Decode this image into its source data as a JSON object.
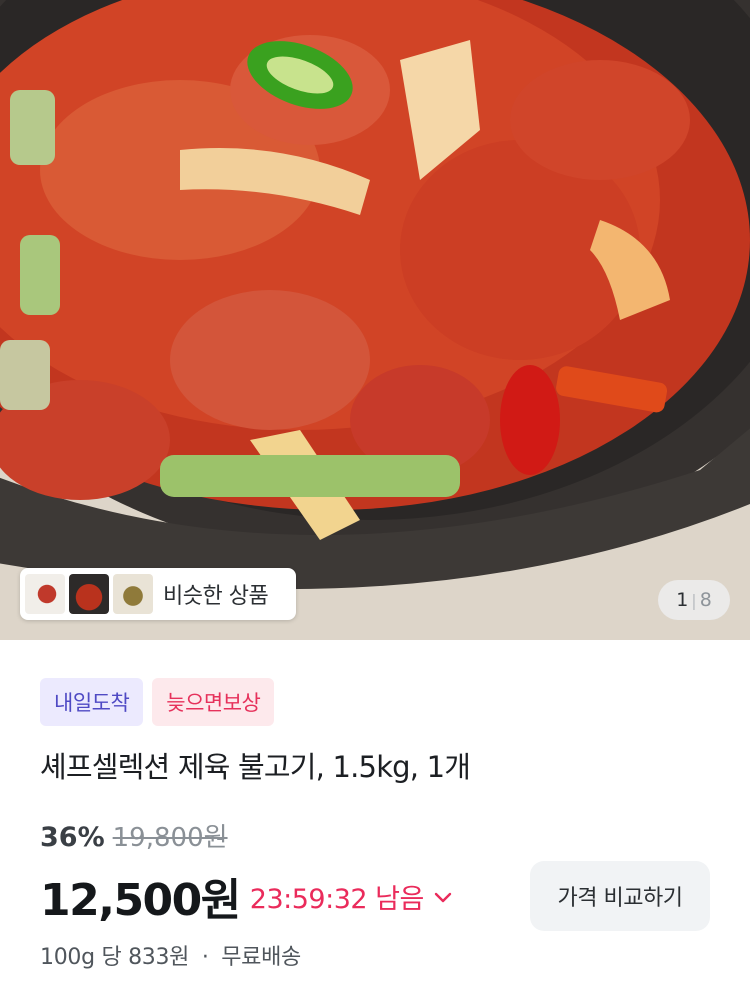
{
  "hero": {
    "image_alt": "제육 불고기 plated in a black stone pan",
    "similar": {
      "label": "비슷한 상품"
    },
    "pager": {
      "current": "1",
      "separator": "|",
      "total": "8"
    }
  },
  "badges": {
    "arrival": "내일도착",
    "late": "늦으면보상"
  },
  "product": {
    "title": "셰프셀렉션 제육 불고기, 1.5kg, 1개"
  },
  "pricing": {
    "discount": "36%",
    "original_price": "19,800원",
    "sale_price": "12,500원",
    "timer": "23:59:32 남음",
    "compare_button": "가격 비교하기",
    "unit_price": "100g 당 833원",
    "shipping": "무료배송",
    "separator": "·"
  },
  "colors": {
    "accent_red": "#ea2b5b",
    "arrival_badge_text": "#4f4ac4",
    "arrival_badge_bg": "#eceafe",
    "late_badge_text": "#e6315b",
    "late_badge_bg": "#fde9ec"
  },
  "icons": {
    "timer_toggle": "chevron-down-icon"
  }
}
